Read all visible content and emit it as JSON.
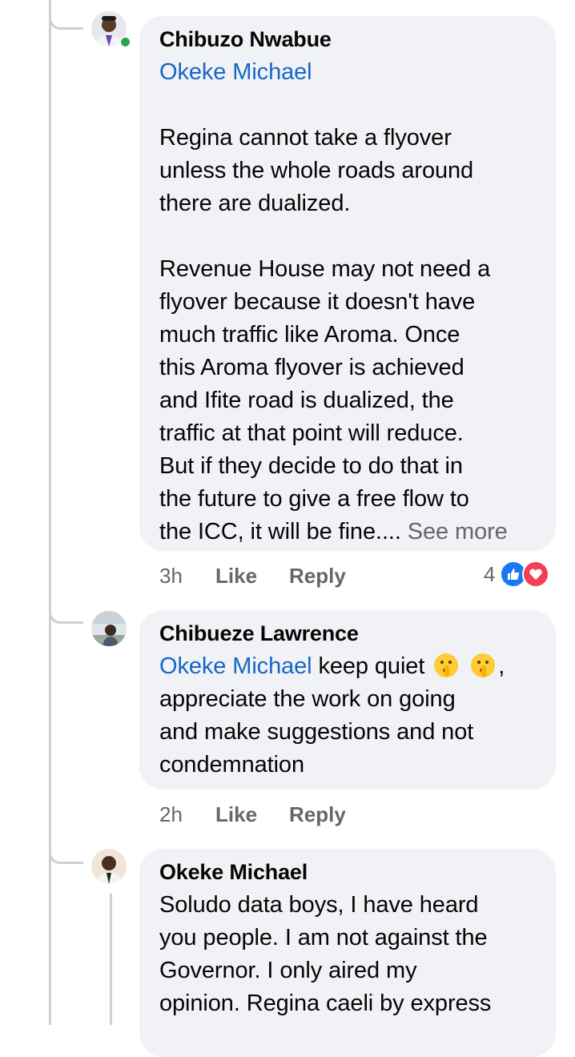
{
  "comments": [
    {
      "author": "Chibuzo Nwabue",
      "mention": "Okeke Michael",
      "paragraph1": "Regina cannot take a flyover\nunless the whole roads around\nthere are dualized.",
      "paragraph2": "Revenue House may not need a\nflyover because it doesn't have\nmuch traffic like Aroma. Once\nthis Aroma flyover is achieved\nand Ifite road is dualized, the\ntraffic at that point will reduce.\nBut if they decide to do that in\nthe future to give a free flow to\nthe ICC, it will be fine.... ",
      "see_more": "See more",
      "time": "3h",
      "like": "Like",
      "reply": "Reply",
      "reaction_count": "4",
      "reactions": [
        "like-icon",
        "love-icon"
      ],
      "online": true
    },
    {
      "author": "Chibueze Lawrence",
      "mention": "Okeke Michael",
      "text_after_mention": " keep quiet",
      "emoji": "shushing-face",
      "text_rest": "appreciate the work on going\nand make suggestions and not\ncondemnation",
      "time": "2h",
      "like": "Like",
      "reply": "Reply"
    },
    {
      "author": "Okeke Michael",
      "text": "Soludo data boys, I have heard\nyou people. I am not against the\nGovernor. I only aired my\nopinion. Regina caeli by express"
    }
  ],
  "colors": {
    "bubble": "#f0f2f5",
    "mention": "#1766c7",
    "meta": "#65676b",
    "like_reaction": "#1877f2",
    "love_reaction": "#f33e58",
    "online": "#31a24c"
  }
}
